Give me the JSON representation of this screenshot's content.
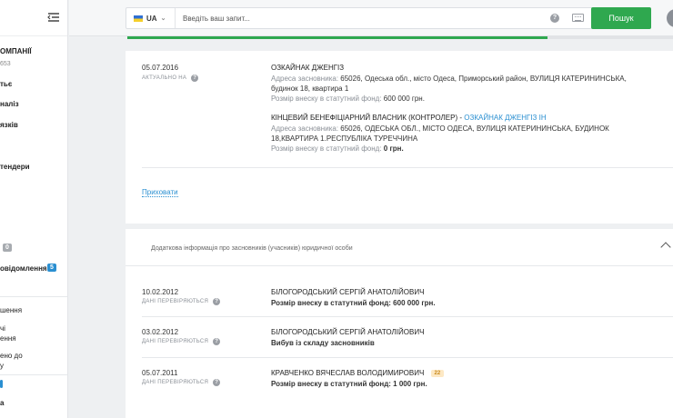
{
  "sidebar": {
    "company": "ОМПАНІЇ",
    "code": "653",
    "items": [
      {
        "label": "тьє"
      },
      {
        "label": "наліз"
      },
      {
        "label": "язків"
      },
      {
        "label": "тендери"
      }
    ],
    "badge_count": "0",
    "notifications_label": "овідомлення",
    "notifications_count": "5",
    "lower_items": [
      {
        "label": "шення"
      },
      {
        "label": "чі"
      },
      {
        "label": "ення"
      },
      {
        "label": "ено до"
      },
      {
        "label": "у"
      }
    ],
    "bottom_badge": "",
    "bottom_label": "а"
  },
  "header": {
    "lang": "UA",
    "search_placeholder": "Введіть ваш запит...",
    "search_button": "Пошук",
    "help": "?",
    "avatar_initial": "",
    "progress": 0.77
  },
  "founders_current": {
    "date": "05.07.2016",
    "status": "АКТУАЛЬНО НА",
    "entries": [
      {
        "name": "ОЗКАЙНАК ДЖЕНГІЗ",
        "address_label": "Адреса засновника:",
        "address": "65026, Одеська обл., місто Одеса, Приморський район, ВУЛИЦЯ КАТЕРИНИНСЬКА,",
        "address2": "будинок 18, квартира 1",
        "capital_label": "Розмір внеску в статутний фонд:",
        "capital": "600 000 грн."
      },
      {
        "role": "КІНЦЕВИЙ БЕНЕФІЦІАРНИЙ ВЛАСНИК (КОНТРОЛЕР)",
        "role_sep": "-",
        "name_link": "ОЗКАЙНАК ДЖЕНГІЗ ІН",
        "address_label": "Адреса засновника:",
        "address": "65026, ОДЕСЬКА ОБЛ., МІСТО ОДЕСА, ВУЛИЦЯ КАТЕРИНИНСЬКА, БУДИНОК",
        "address2": "18,КВАРТИРА 1.РЕСПУБЛІКА ТУРЕЧЧИНА",
        "capital_label": "Розмір внеску в статутний фонд:",
        "capital": "0 грн."
      }
    ],
    "hide_link": "Приховати"
  },
  "founders_history": {
    "title": "Додаткова інформація про засновників (учасників) юридичної особи",
    "rows": [
      {
        "date": "10.02.2012",
        "status": "ДАНІ ПЕРЕВІРЯЮТЬСЯ",
        "name": "БІЛОГОРОДСЬКИЙ СЕРГІЙ АНАТОЛІЙОВИЧ",
        "detail": "Розмір внеску в статутний фонд: 600 000 грн.",
        "badge": ""
      },
      {
        "date": "03.02.2012",
        "status": "ДАНІ ПЕРЕВІРЯЮТЬСЯ",
        "name": "БІЛОГОРОДСЬКИЙ СЕРГІЙ АНАТОЛІЙОВИЧ",
        "detail": "Вибув із складу засновників",
        "badge": ""
      },
      {
        "date": "05.07.2011",
        "status": "ДАНІ ПЕРЕВІРЯЮТЬСЯ",
        "name": "КРАВЧЕНКО ВЯЧЕСЛАВ ВОЛОДИМИРОВИЧ",
        "detail": "Розмір внеску в статутний фонд: 1 000 грн.",
        "badge": "22"
      }
    ]
  },
  "colors": {
    "accent": "#2fa84f",
    "link": "#2a8fd1"
  }
}
